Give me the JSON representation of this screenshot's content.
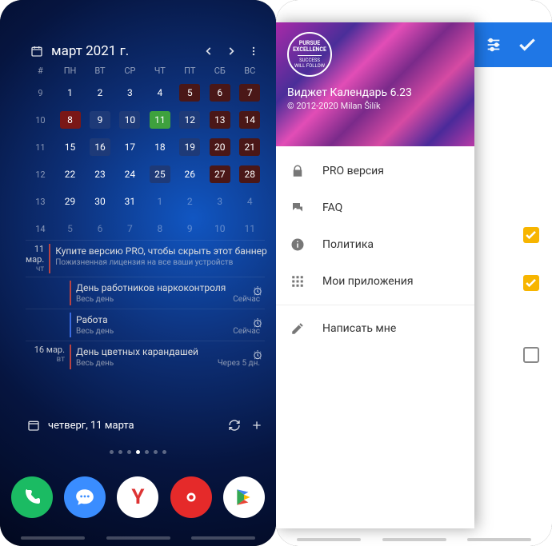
{
  "left": {
    "title": "март 2021 г.",
    "dow": [
      "#",
      "ПН",
      "ВТ",
      "СР",
      "ЧТ",
      "ПТ",
      "СБ",
      "ВС"
    ],
    "weeks": [
      {
        "wn": "9",
        "d": [
          {
            "n": "1"
          },
          {
            "n": "2"
          },
          {
            "n": "3"
          },
          {
            "n": "4"
          },
          {
            "n": "5",
            "c": "darkred"
          },
          {
            "n": "6",
            "c": "darkred"
          },
          {
            "n": "7",
            "c": "darkred"
          }
        ]
      },
      {
        "wn": "10",
        "d": [
          {
            "n": "8",
            "c": "red"
          },
          {
            "n": "9",
            "c": "blue"
          },
          {
            "n": "10",
            "c": "blue"
          },
          {
            "n": "11",
            "c": "green"
          },
          {
            "n": "12",
            "c": "blue"
          },
          {
            "n": "13",
            "c": "darkred"
          },
          {
            "n": "14",
            "c": "darkred"
          }
        ]
      },
      {
        "wn": "11",
        "d": [
          {
            "n": "15"
          },
          {
            "n": "16",
            "c": "blue"
          },
          {
            "n": "17"
          },
          {
            "n": "18"
          },
          {
            "n": "19",
            "c": "blue"
          },
          {
            "n": "20",
            "c": "darkred"
          },
          {
            "n": "21",
            "c": "darkred"
          }
        ]
      },
      {
        "wn": "12",
        "d": [
          {
            "n": "22"
          },
          {
            "n": "23"
          },
          {
            "n": "24"
          },
          {
            "n": "25",
            "c": "blue"
          },
          {
            "n": "26"
          },
          {
            "n": "27",
            "c": "darkred"
          },
          {
            "n": "28",
            "c": "darkred"
          }
        ]
      },
      {
        "wn": "13",
        "d": [
          {
            "n": "29"
          },
          {
            "n": "30"
          },
          {
            "n": "31"
          },
          {
            "n": "1",
            "dim": true
          },
          {
            "n": "2",
            "dim": true
          },
          {
            "n": "3",
            "dim": true
          },
          {
            "n": "4",
            "dim": true
          }
        ]
      },
      {
        "wn": "14",
        "d": [
          {
            "n": "5",
            "dim": true
          },
          {
            "n": "6",
            "dim": true
          },
          {
            "n": "7",
            "dim": true
          },
          {
            "n": "8",
            "dim": true
          },
          {
            "n": "9",
            "dim": true
          },
          {
            "n": "10",
            "dim": true
          },
          {
            "n": "11",
            "dim": true
          }
        ]
      }
    ],
    "agenda": [
      {
        "date": "11 мар.",
        "day": "чт",
        "items": [
          {
            "title": "Купите версию PRO, чтобы скрыть этот баннер",
            "sub": "Пожизненная лицензия на все ваши устройств",
            "bar": "red"
          },
          {
            "title": "День работников наркоконтроля",
            "sub": "Весь день",
            "right": "Сейчас",
            "bar": "red",
            "bell": true
          },
          {
            "title": "Работа",
            "sub": "Весь день",
            "right": "Сейчас",
            "bar": "blue",
            "bell": true
          }
        ]
      },
      {
        "date": "16 мар.",
        "day": "вт",
        "items": [
          {
            "title": "День цветных карандашей",
            "sub": "Весь день",
            "right": "Через 5 дн.",
            "bar": "red",
            "bell": true
          }
        ]
      }
    ],
    "footer": "четверг, 11 марта"
  },
  "right": {
    "badge": {
      "l1": "PURSUE",
      "l2": "EXCELLENCE",
      "l3": "SUCCESS",
      "l4": "WILL FOLLOW"
    },
    "appName": "Виджет Календарь 6.23",
    "copyright": "© 2012-2020 Milan Šilík",
    "menu": [
      {
        "icon": "lock",
        "label": "PRO версия"
      },
      {
        "icon": "faq",
        "label": "FAQ"
      },
      {
        "icon": "info",
        "label": "Политика"
      },
      {
        "icon": "grid",
        "label": "Мои приложения"
      },
      {
        "sep": true
      },
      {
        "icon": "pen",
        "label": "Написать мне"
      }
    ]
  }
}
